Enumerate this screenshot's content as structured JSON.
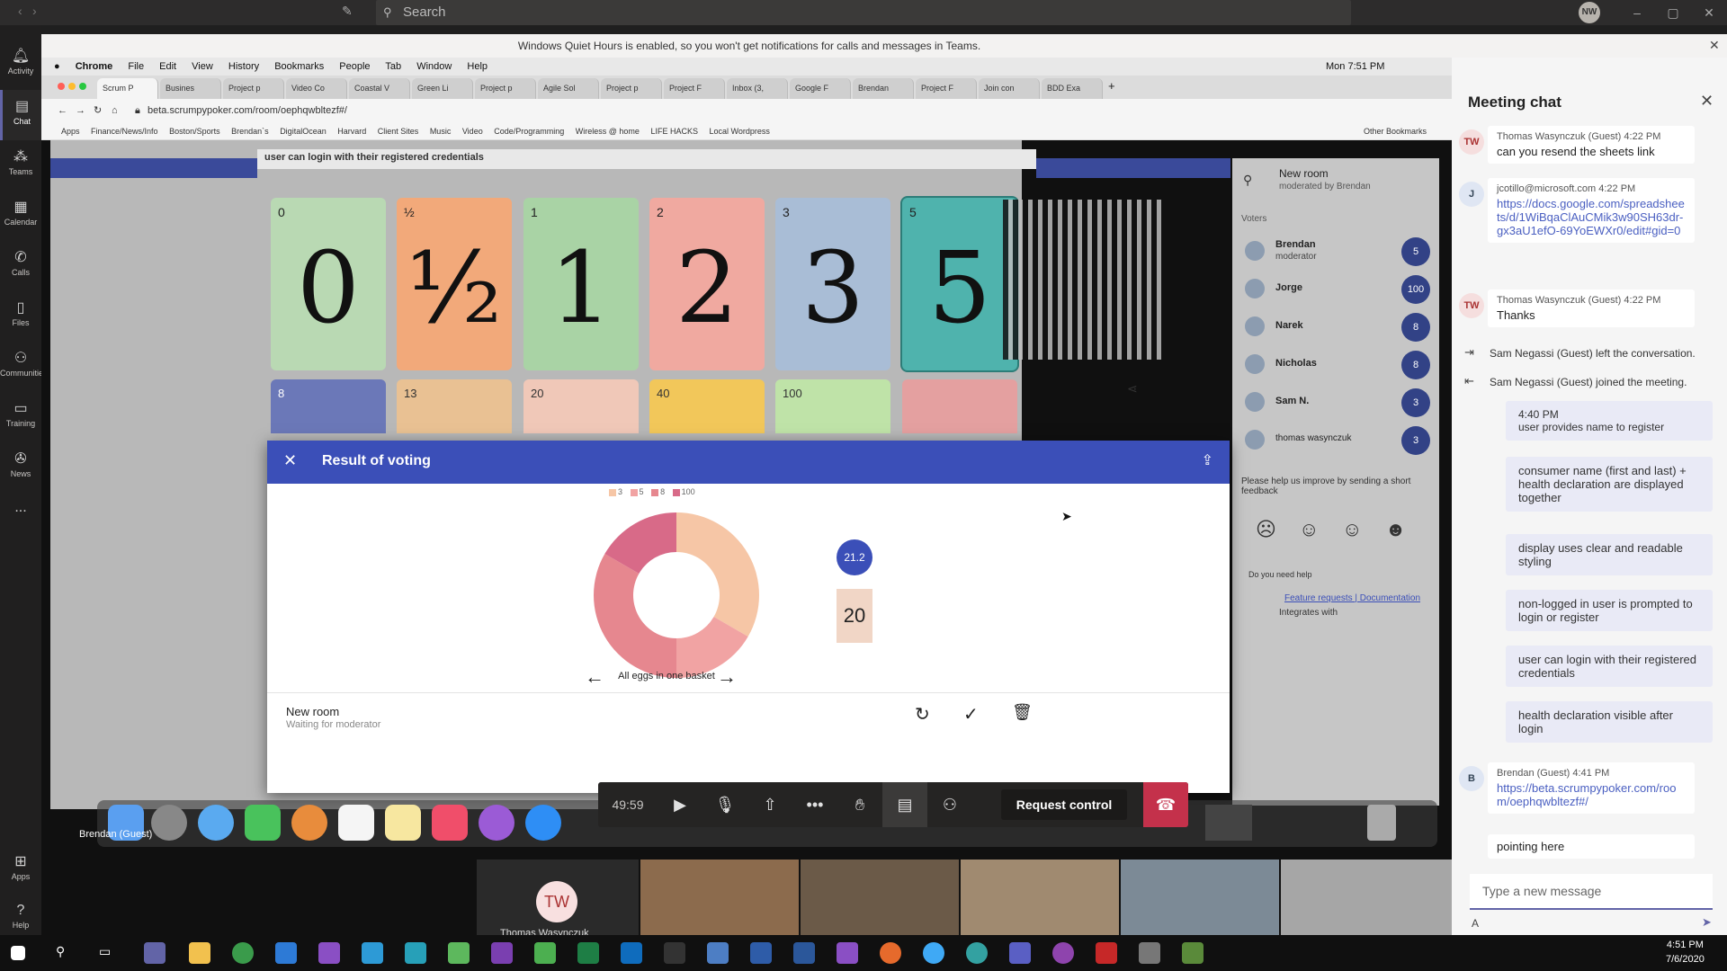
{
  "teams": {
    "search_placeholder": "Search",
    "avatar_initials": "NW",
    "rail": [
      {
        "label": "Activity",
        "icon": "bell-icon"
      },
      {
        "label": "Chat",
        "icon": "chat-icon"
      },
      {
        "label": "Teams",
        "icon": "teams-icon"
      },
      {
        "label": "Calendar",
        "icon": "calendar-icon"
      },
      {
        "label": "Calls",
        "icon": "phone-icon"
      },
      {
        "label": "Files",
        "icon": "file-icon"
      },
      {
        "label": "Communities",
        "icon": "communities-icon"
      },
      {
        "label": "Training",
        "icon": "training-icon"
      },
      {
        "label": "News",
        "icon": "news-icon"
      },
      {
        "label": "...",
        "icon": "more-icon"
      },
      {
        "label": "Apps",
        "icon": "apps-icon"
      },
      {
        "label": "Help",
        "icon": "help-icon"
      }
    ],
    "quiet_banner": "Windows Quiet Hours is enabled, so you won't get notifications for calls and messages in Teams."
  },
  "mac": {
    "menu": [
      "Chrome",
      "File",
      "Edit",
      "View",
      "History",
      "Bookmarks",
      "People",
      "Tab",
      "Window",
      "Help"
    ],
    "clock": "Mon 7:51 PM"
  },
  "browser": {
    "tabs": [
      "Scrum P",
      "Busines",
      "Project p",
      "Video Co",
      "Coastal V",
      "Green Li",
      "Project p",
      "Agile Sol",
      "Project p",
      "Project F",
      "Inbox (3,",
      "Google F",
      "Brendan",
      "Project F",
      "Join con",
      "BDD Exa"
    ],
    "url": "beta.scrumpypoker.com/room/oephqwbltezf#/",
    "bookmarks": [
      "Apps",
      "Finance/News/Info",
      "Boston/Sports",
      "Brendan`s",
      "DigitalOcean",
      "Harvard",
      "Client Sites",
      "Music",
      "Video",
      "Code/Programming",
      "Wireless @ home",
      "LIFE HACKS",
      "Local Wordpress"
    ],
    "other_bookmarks": "Other Bookmarks"
  },
  "poker": {
    "story_text": "user can login with their registered credentials",
    "cards_row1": [
      {
        "v": "0",
        "color": "#b9d9b3"
      },
      {
        "v": "½",
        "color": "#f2a97a"
      },
      {
        "v": "1",
        "color": "#a9d3a5"
      },
      {
        "v": "2",
        "color": "#f0a9a0"
      },
      {
        "v": "3",
        "color": "#a9bdd6"
      },
      {
        "v": "5",
        "color": "#4fb3ad"
      }
    ],
    "cards_row2": [
      {
        "v": "8",
        "color": "#6b78b8"
      },
      {
        "v": "13",
        "color": "#e9c193"
      },
      {
        "v": "20",
        "color": "#f0c8b8"
      },
      {
        "v": "40",
        "color": "#f2c75a"
      },
      {
        "v": "100",
        "color": "#bfe3a8"
      },
      {
        "v": "",
        "color": "#e4a0a0"
      }
    ],
    "room_title": "New room",
    "room_sub": "moderated by Brendan",
    "voters_label": "Voters",
    "voters": [
      {
        "name": "Brendan",
        "sub": "moderator",
        "vote": "5"
      },
      {
        "name": "Jorge",
        "sub": "",
        "vote": "100"
      },
      {
        "name": "Narek",
        "sub": "",
        "vote": "8"
      },
      {
        "name": "Nicholas",
        "sub": "",
        "vote": "8"
      },
      {
        "name": "Sam N.",
        "sub": "",
        "vote": "3"
      },
      {
        "name": "thomas wasynczuk",
        "sub": "",
        "vote": "3"
      }
    ],
    "feedback_text": "Please help us improve by sending a short feedback",
    "help_text": "Do you need help",
    "links": "Feature requests | Documentation",
    "integrates": "Integrates with"
  },
  "modal": {
    "title": "Result of voting",
    "average": "21.2",
    "suggested_card": "20",
    "nav_title": "All eggs in one basket",
    "room_name": "New room",
    "room_status": "Waiting for moderator"
  },
  "chart_data": {
    "type": "pie",
    "donut": true,
    "categories": [
      "3",
      "5",
      "8",
      "100"
    ],
    "values": [
      2,
      1,
      2,
      1
    ],
    "colors": [
      "#f6c6a6",
      "#f1a3a3",
      "#e6878f",
      "#d86a88"
    ]
  },
  "call": {
    "timer": "49:59",
    "request_control": "Request control"
  },
  "participants": {
    "bubble_initials": "TW",
    "names": [
      "Thomas Wasynczuk",
      "Brendan (Guest)"
    ]
  },
  "chat": {
    "title": "Meeting chat",
    "messages": [
      {
        "avatar": "TW",
        "meta": "Thomas Wasynczuk (Guest)  4:22 PM",
        "text": "can you resend the sheets link"
      },
      {
        "avatar": "J",
        "meta": "jcotillo@microsoft.com  4:22 PM",
        "link": "https://docs.google.com/spreadsheets/d/1WiBqaClAuCMik3w90SH63dr-gx3aU1efO-69YoEWXr0/edit#gid=0"
      },
      {
        "avatar": "TW",
        "meta": "Thomas Wasynczuk (Guest)  4:22 PM",
        "text": "Thanks"
      }
    ],
    "sys1": "Sam Negassi (Guest) left the conversation.",
    "sys2": "Sam Negassi (Guest) joined the meeting.",
    "mine": [
      {
        "text": "4:40 PM\nuser provides name to register"
      },
      {
        "text": "consumer name (first and last) + health declaration are displayed together"
      },
      {
        "text": "display uses clear and readable styling"
      },
      {
        "text": "non-logged in user is prompted to login or register"
      },
      {
        "text": "user can login with their registered credentials"
      },
      {
        "text": "health declaration visible after login"
      }
    ],
    "last_meta": "Brendan (Guest)  4:41 PM",
    "last_link": "https://beta.scrumpypoker.com/room/oephqwbltezf#/",
    "last_text": "pointing here",
    "compose_placeholder": "Type a new message"
  },
  "taskbar": {
    "time": "4:51 PM",
    "date": "7/6/2020"
  }
}
